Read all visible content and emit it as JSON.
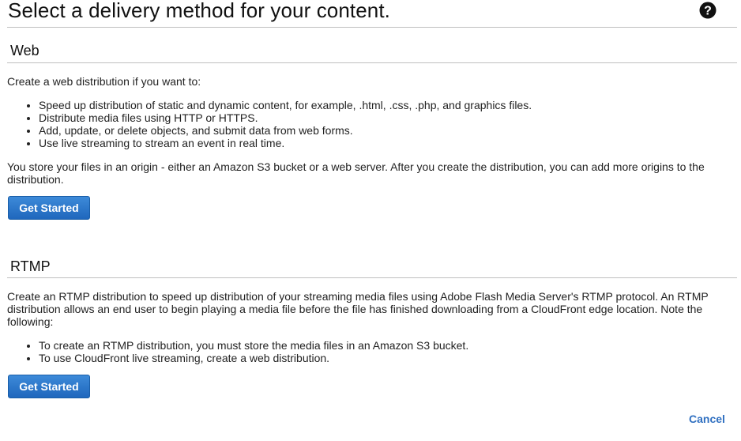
{
  "page": {
    "title": "Select a delivery method for your content.",
    "help_icon": "help-circle-icon"
  },
  "web": {
    "heading": "Web",
    "intro": "Create a web distribution if you want to:",
    "bullets": [
      "Speed up distribution of static and dynamic content, for example, .html, .css, .php, and graphics files.",
      "Distribute media files using HTTP or HTTPS.",
      "Add, update, or delete objects, and submit data from web forms.",
      "Use live streaming to stream an event in real time."
    ],
    "origin_note": "You store your files in an origin - either an Amazon S3 bucket or a web server. After you create the distribution, you can add more origins to the distribution.",
    "button_label": "Get Started"
  },
  "rtmp": {
    "heading": "RTMP",
    "intro": "Create an RTMP distribution to speed up distribution of your streaming media files using Adobe Flash Media Server's RTMP protocol. An RTMP distribution allows an end user to begin playing a media file before the file has finished downloading from a CloudFront edge location. Note the following:",
    "bullets": [
      "To create an RTMP distribution, you must store the media files in an Amazon S3 bucket.",
      "To use CloudFront live streaming, create a web distribution."
    ],
    "button_label": "Get Started"
  },
  "footer": {
    "cancel_label": "Cancel"
  },
  "colors": {
    "button_top": "#3d8ad9",
    "button_bottom": "#1f67bd",
    "link": "#2f6fc0"
  }
}
